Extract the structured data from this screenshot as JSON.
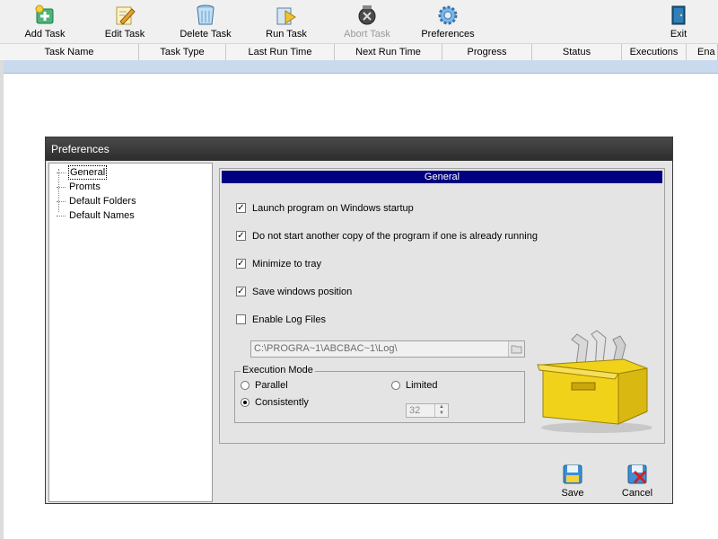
{
  "toolbar": {
    "items": [
      {
        "label": "Add Task",
        "icon": "add-task-icon"
      },
      {
        "label": "Edit Task",
        "icon": "edit-task-icon"
      },
      {
        "label": "Delete Task",
        "icon": "delete-task-icon"
      },
      {
        "label": "Run Task",
        "icon": "run-task-icon"
      },
      {
        "label": "Abort Task",
        "icon": "abort-task-icon",
        "disabled": true
      },
      {
        "label": "Preferences",
        "icon": "preferences-icon"
      },
      {
        "label": "Exit",
        "icon": "exit-icon"
      }
    ]
  },
  "columns": [
    "Task Name",
    "Task Type",
    "Last Run Time",
    "Next Run Time",
    "Progress",
    "Status",
    "Executions",
    "Ena"
  ],
  "dialog": {
    "title": "Preferences",
    "tree": [
      {
        "label": "General",
        "selected": true
      },
      {
        "label": "Promts"
      },
      {
        "label": "Default Folders"
      },
      {
        "label": "Default Names"
      }
    ],
    "panel_title": "General",
    "options": [
      {
        "label": "Launch program on Windows startup",
        "checked": true
      },
      {
        "label": "Do not start another copy of the program if one is already running",
        "checked": true
      },
      {
        "label": "Minimize to tray",
        "checked": true
      },
      {
        "label": "Save windows position",
        "checked": true
      },
      {
        "label": "Enable Log Files",
        "checked": false
      }
    ],
    "log_path": "C:\\PROGRA~1\\ABCBAC~1\\Log\\",
    "execution_mode": {
      "legend": "Execution Mode",
      "parallel": "Parallel",
      "consistently": "Consistently",
      "limited": "Limited",
      "selected": "Consistently",
      "limit_value": "32"
    },
    "save_label": "Save",
    "cancel_label": "Cancel"
  },
  "colors": {
    "panel_header": "#000080",
    "selected_row": "#c9d9ee",
    "titlebar": "#2c2c2c"
  }
}
